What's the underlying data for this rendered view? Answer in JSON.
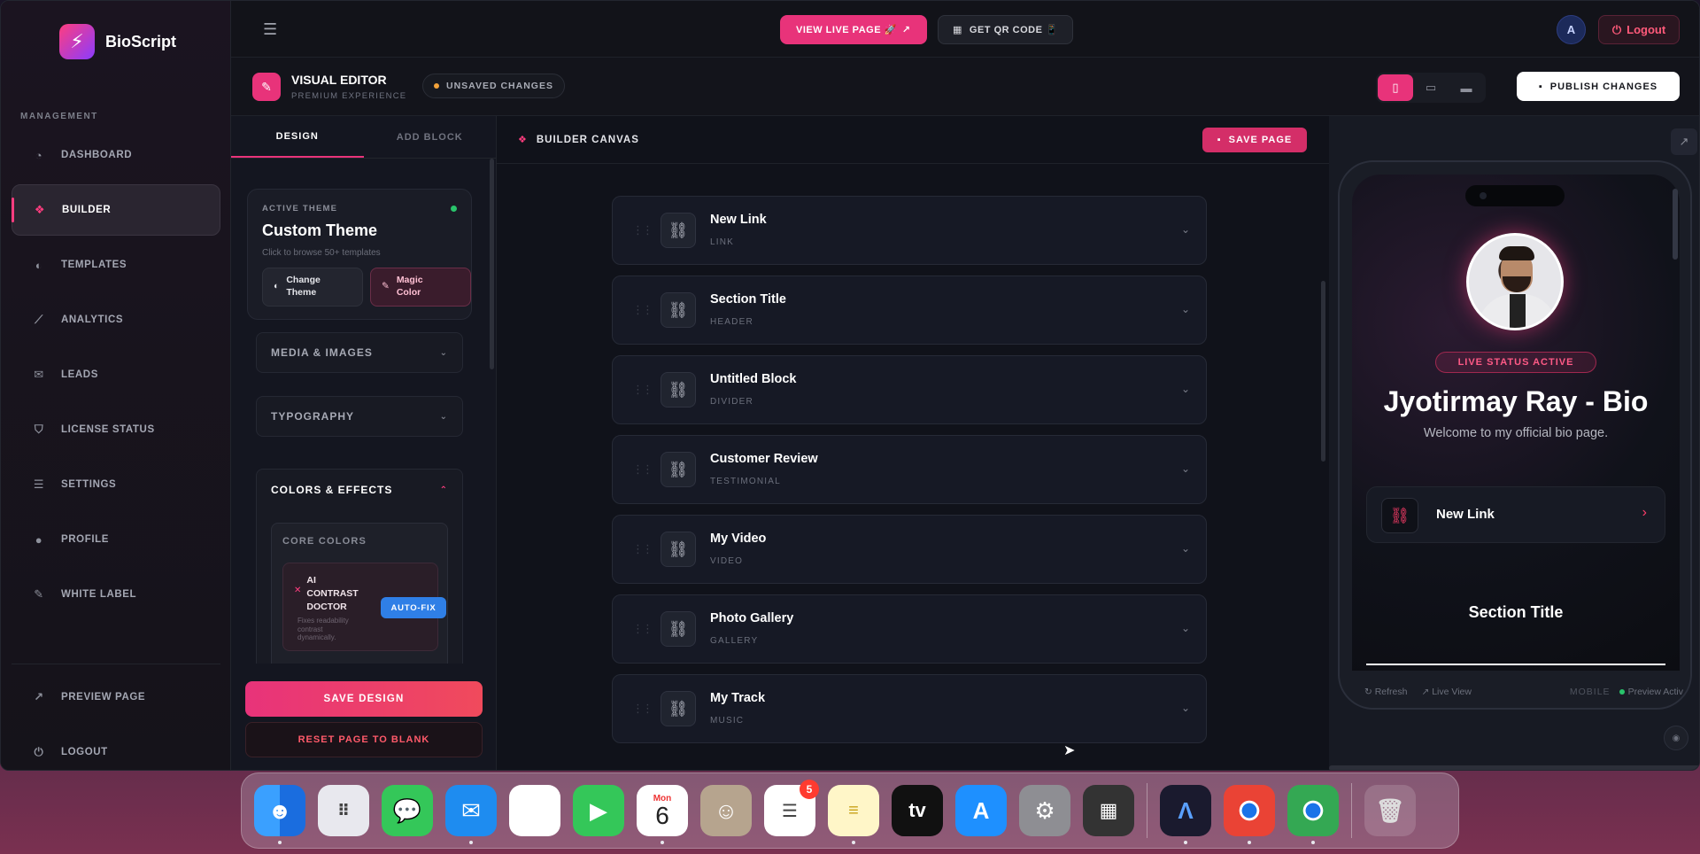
{
  "brand": {
    "name": "BioScript",
    "logo_icon": "bolt-icon"
  },
  "sidebar": {
    "section_label": "MANAGEMENT",
    "items": [
      {
        "label": "DASHBOARD",
        "icon": "pie-icon"
      },
      {
        "label": "BUILDER",
        "icon": "layers-icon",
        "active": true
      },
      {
        "label": "TEMPLATES",
        "icon": "palette-icon"
      },
      {
        "label": "ANALYTICS",
        "icon": "chart-icon"
      },
      {
        "label": "LEADS",
        "icon": "mail-icon"
      },
      {
        "label": "LICENSE STATUS",
        "icon": "shield-icon"
      },
      {
        "label": "SETTINGS",
        "icon": "sliders-icon"
      },
      {
        "label": "PROFILE",
        "icon": "user-icon"
      },
      {
        "label": "WHITE LABEL",
        "icon": "brush-icon"
      }
    ],
    "bottom": [
      {
        "label": "PREVIEW PAGE",
        "icon": "external-icon"
      },
      {
        "label": "LOGOUT",
        "icon": "power-icon"
      }
    ]
  },
  "topbar": {
    "view_live": "VIEW LIVE PAGE 🚀",
    "get_qr": "GET QR CODE 📱",
    "avatar_initial": "A",
    "logout": "Logout"
  },
  "editor": {
    "title": "VISUAL EDITOR",
    "subtitle": "PREMIUM EXPERIENCE",
    "status": "UNSAVED CHANGES",
    "publish": "PUBLISH CHANGES",
    "active_device": "mobile"
  },
  "panel": {
    "tabs": [
      "DESIGN",
      "ADD BLOCK"
    ],
    "active_theme_label": "ACTIVE THEME",
    "theme_name": "Custom Theme",
    "theme_hint": "Click to browse 50+ templates",
    "change_theme": "Change Theme",
    "magic_color": "Magic Color",
    "media": "MEDIA & IMAGES",
    "typography": "TYPOGRAPHY",
    "colors": "COLORS & EFFECTS",
    "core_colors": "CORE COLORS",
    "ai_title": "AI CONTRAST DOCTOR",
    "ai_desc": "Fixes readability contrast dynamically.",
    "auto_fix": "AUTO-FIX",
    "save_design": "SAVE DESIGN",
    "reset_page": "RESET PAGE TO BLANK"
  },
  "canvas": {
    "title": "BUILDER CANVAS",
    "save_page": "SAVE PAGE",
    "blocks": [
      {
        "name": "New Link",
        "type": "LINK"
      },
      {
        "name": "Section Title",
        "type": "HEADER"
      },
      {
        "name": "Untitled Block",
        "type": "DIVIDER"
      },
      {
        "name": "Customer Review",
        "type": "TESTIMONIAL"
      },
      {
        "name": "My Video",
        "type": "VIDEO"
      },
      {
        "name": "Photo Gallery",
        "type": "GALLERY"
      },
      {
        "name": "My Track",
        "type": "MUSIC"
      }
    ]
  },
  "preview": {
    "status_badge": "LIVE STATUS ACTIVE",
    "name": "Jyotirmay Ray - Bio",
    "bio": "Welcome to my official bio page.",
    "link_label": "New Link",
    "section_title": "Section Title",
    "footer": {
      "refresh": "Refresh",
      "live_view": "Live View",
      "mode": "MOBILE",
      "preview_status": "Preview Activ"
    }
  },
  "dock": {
    "apps": [
      "Finder",
      "Launchpad",
      "Messages",
      "Mail",
      "Photos",
      "FaceTime",
      "Calendar",
      "Contacts",
      "Reminders",
      "Notes",
      "TV",
      "App Store",
      "System Settings",
      "Calculator",
      "Arc",
      "Chrome",
      "Chrome",
      "Trash"
    ],
    "calendar_month": "Mon",
    "calendar_day": "6",
    "reminders_badge": "5",
    "tv_label": "tv"
  },
  "colors": {
    "accent": "#e8337a",
    "success": "#29c46b",
    "autofix": "#2f7fe6"
  }
}
